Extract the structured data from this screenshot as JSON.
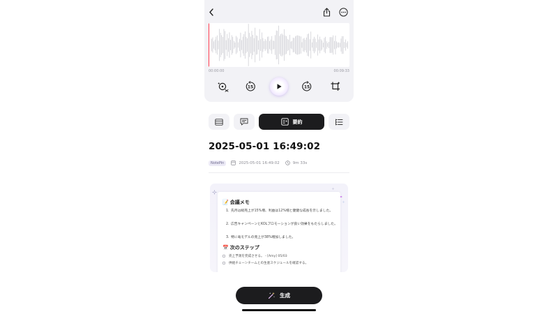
{
  "header": {
    "back_icon": "chevron-left-icon",
    "share_icon": "share-icon",
    "more_icon": "more-horizontal-icon"
  },
  "player": {
    "current_time": "00:00:00",
    "total_time": "00:09:33",
    "playback_progress": 0,
    "controls": {
      "speed_icon": "playback-speed-icon",
      "rewind_icon": "rewind-15-icon",
      "rewind_label": "15",
      "play_icon": "play-icon",
      "forward_icon": "forward-15-icon",
      "forward_label": "15",
      "trim_icon": "crop-trim-icon"
    },
    "colors": {
      "playhead": "#ff3b4e",
      "waveform": "#c9c9cf"
    }
  },
  "tabs": [
    {
      "icon": "list-lines-icon",
      "label": "",
      "active": false
    },
    {
      "icon": "chat-bubble-icon",
      "label": "",
      "active": false
    },
    {
      "icon": "ai-summary-icon",
      "label": "要約",
      "active": true
    },
    {
      "icon": "outline-list-icon",
      "label": "",
      "active": false
    }
  ],
  "recording": {
    "title": "2025-05-01 16:49:02",
    "source_badge": "NotePin",
    "date": "2025-05-01 16:49:02",
    "duration": "9m 33s"
  },
  "summary_preview": {
    "section1_emoji": "📝",
    "section1_title": "会議メモ",
    "items": [
      {
        "num": "1.",
        "text": "先月は総売上が15%増、利益は12%増と健健な成長を示しました。"
      },
      {
        "num": "2.",
        "text": "広告キャンペーンとKOLプロモーションが良い効果をもたらしました。"
      },
      {
        "num": "3.",
        "text": "特に竜モデルの売上が38%増加しました。"
      }
    ],
    "section2_emoji": "📅",
    "section2_title": "次のステップ",
    "steps": [
      {
        "text": "売上予測を完成させる。 - [Amy] 05/03"
      },
      {
        "text": "供給チェーンチームとの生産スケジュールを確認する。"
      }
    ]
  },
  "generate_button": {
    "icon": "magic-wand-icon",
    "label": "生成"
  }
}
